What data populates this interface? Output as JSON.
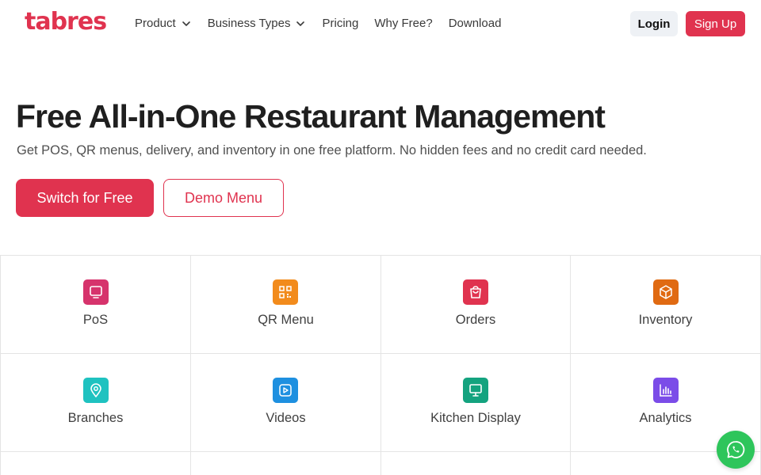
{
  "brand": {
    "name": "tabres",
    "accent": "#e0334f"
  },
  "nav": {
    "items": [
      {
        "label": "Product",
        "dropdown": true
      },
      {
        "label": "Business Types",
        "dropdown": true
      },
      {
        "label": "Pricing",
        "dropdown": false
      },
      {
        "label": "Why Free?",
        "dropdown": false
      },
      {
        "label": "Download",
        "dropdown": false
      }
    ],
    "login_label": "Login",
    "signup_label": "Sign Up"
  },
  "hero": {
    "title": "Free All-in-One Restaurant Management",
    "subtitle": "Get POS, QR menus, delivery, and inventory in one free platform. No hidden fees and no credit card needed.",
    "primary_cta": "Switch for Free",
    "secondary_cta": "Demo Menu"
  },
  "features": [
    {
      "label": "PoS",
      "icon": "monitor-icon",
      "color": "#d6336c"
    },
    {
      "label": "QR Menu",
      "icon": "qr-code-icon",
      "color": "#f28b1c"
    },
    {
      "label": "Orders",
      "icon": "shopping-bag-icon",
      "color": "#e0334f"
    },
    {
      "label": "Inventory",
      "icon": "box-icon",
      "color": "#e06a12"
    },
    {
      "label": "Branches",
      "icon": "location-pin-icon",
      "color": "#1fc2c0"
    },
    {
      "label": "Videos",
      "icon": "play-icon",
      "color": "#1e90e0"
    },
    {
      "label": "Kitchen Display",
      "icon": "display-icon",
      "color": "#14a37f"
    },
    {
      "label": "Analytics",
      "icon": "bar-chart-icon",
      "color": "#7b4ce8"
    }
  ],
  "whatsapp": {
    "icon": "whatsapp-icon",
    "color": "#2ec55b"
  }
}
